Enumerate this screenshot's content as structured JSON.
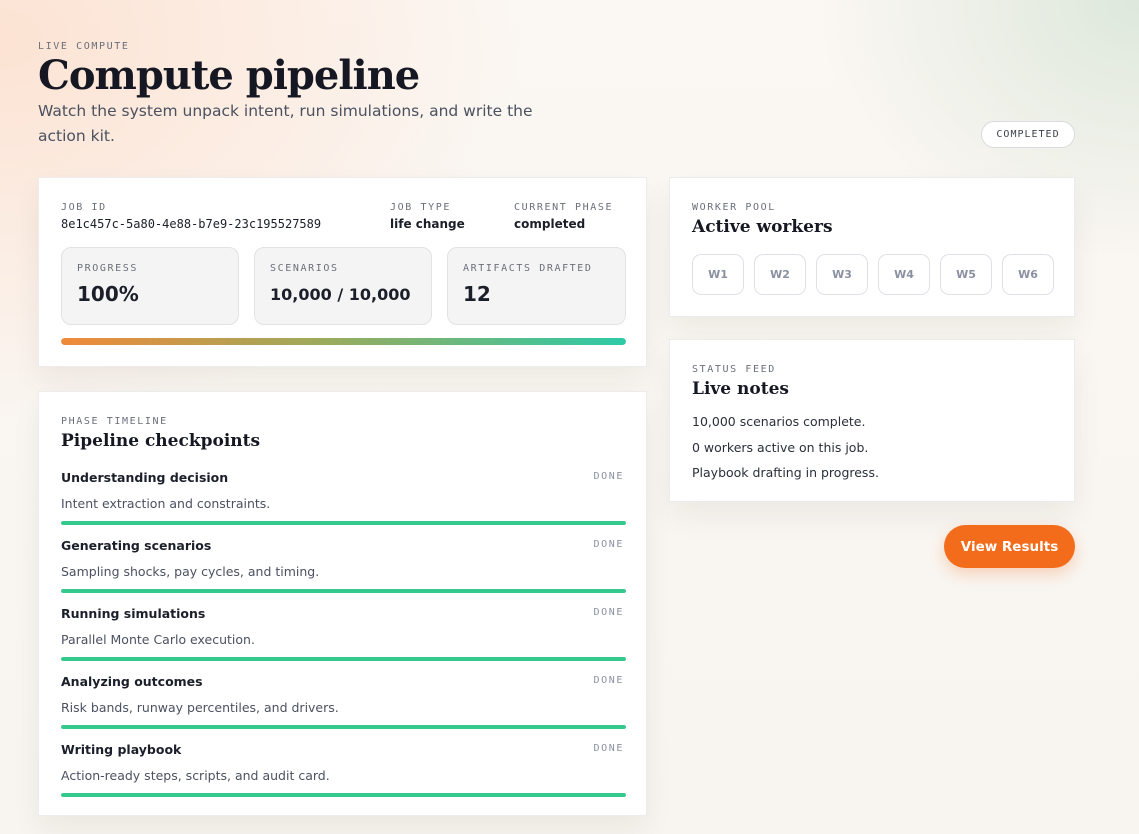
{
  "header": {
    "eyebrow": "LIVE COMPUTE",
    "title": "Compute pipeline",
    "subtitle": "Watch the system unpack intent, run simulations, and write the action kit.",
    "status": "COMPLETED"
  },
  "job": {
    "id_label": "JOB ID",
    "id": "8e1c457c-5a80-4e88-b7e9-23c195527589",
    "type_label": "JOB TYPE",
    "type": "life change",
    "phase_label": "CURRENT PHASE",
    "phase": "completed",
    "stats": {
      "progress_label": "PROGRESS",
      "progress": "100%",
      "progress_fraction": 1.0,
      "scenarios_label": "SCENARIOS",
      "scenarios": "10,000 / 10,000",
      "artifacts_label": "ARTIFACTS DRAFTED",
      "artifacts": "12"
    }
  },
  "workers": {
    "eyebrow": "WORKER POOL",
    "title": "Active workers",
    "items": [
      "W1",
      "W2",
      "W3",
      "W4",
      "W5",
      "W6"
    ]
  },
  "feed": {
    "eyebrow": "STATUS FEED",
    "title": "Live notes",
    "lines": [
      "10,000 scenarios complete.",
      "0 workers active on this job.",
      "Playbook drafting in progress."
    ]
  },
  "actions": {
    "view_results": "View Results"
  },
  "timeline": {
    "eyebrow": "PHASE TIMELINE",
    "title": "Pipeline checkpoints",
    "phases": [
      {
        "name": "Understanding decision",
        "status": "DONE",
        "desc": "Intent extraction and constraints.",
        "progress": 1.0
      },
      {
        "name": "Generating scenarios",
        "status": "DONE",
        "desc": "Sampling shocks, pay cycles, and timing.",
        "progress": 1.0
      },
      {
        "name": "Running simulations",
        "status": "DONE",
        "desc": "Parallel Monte Carlo execution.",
        "progress": 1.0
      },
      {
        "name": "Analyzing outcomes",
        "status": "DONE",
        "desc": "Risk bands, runway percentiles, and drivers.",
        "progress": 1.0
      },
      {
        "name": "Writing playbook",
        "status": "DONE",
        "desc": "Action-ready steps, scripts, and audit card.",
        "progress": 1.0
      }
    ]
  },
  "colors": {
    "accent": "#f26c1c",
    "done_bar": "#35c98e",
    "progress_start": "#f08a3a",
    "progress_end": "#2dcaa8"
  }
}
